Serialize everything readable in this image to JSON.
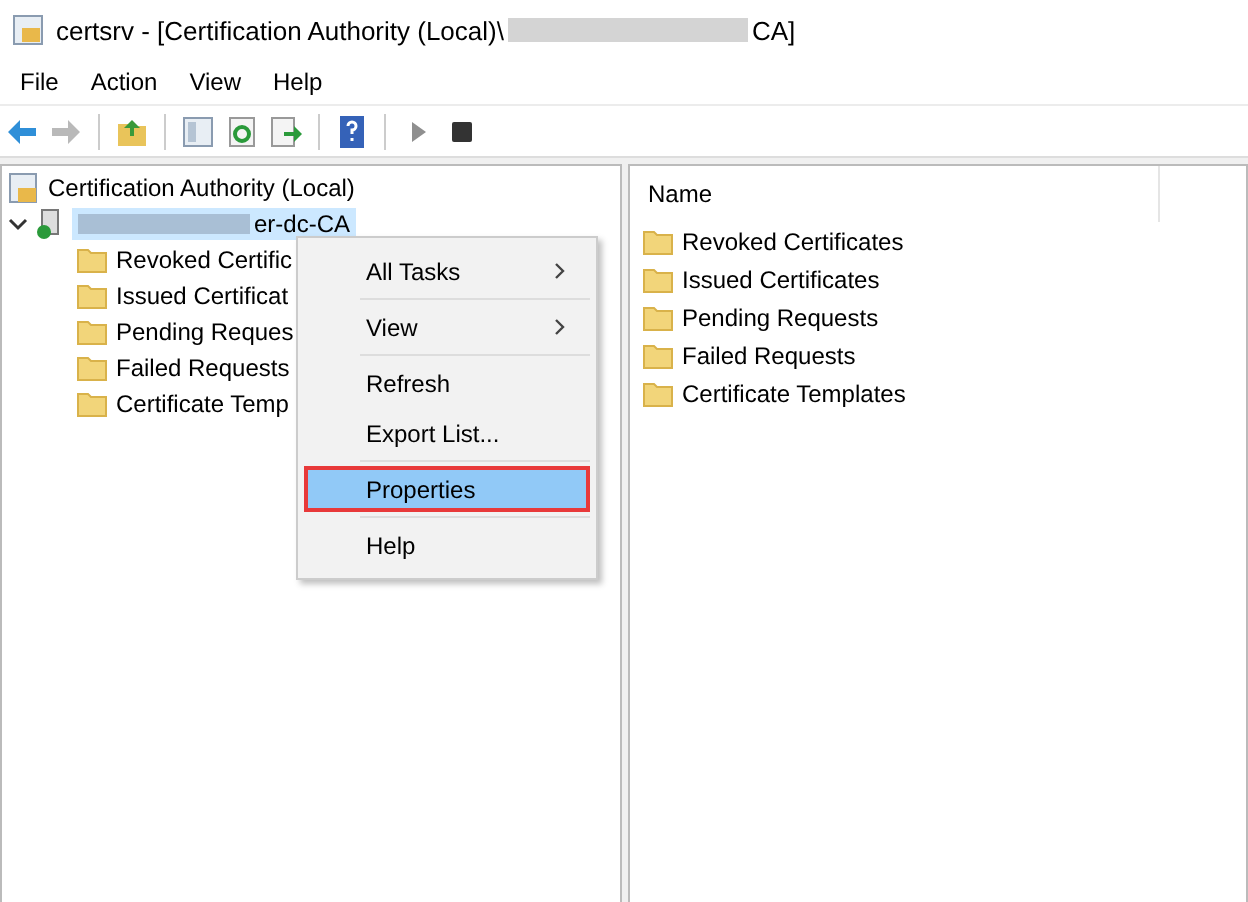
{
  "window": {
    "title": "certsrv - [Certification Authority (Local)\\",
    "title_end": "CA]"
  },
  "menu_bar": [
    "File",
    "Action",
    "View",
    "Help"
  ],
  "toolbar": [
    {
      "kind": "back",
      "disabled": false
    },
    {
      "kind": "forward",
      "disabled": true
    },
    {
      "kind": "separator"
    },
    {
      "kind": "up",
      "disabled": false
    },
    {
      "kind": "separator"
    },
    {
      "kind": "console",
      "disabled": false
    },
    {
      "kind": "refresh",
      "disabled": false
    },
    {
      "kind": "export",
      "disabled": false
    },
    {
      "kind": "separator"
    },
    {
      "kind": "help",
      "disabled": false
    },
    {
      "kind": "separator"
    },
    {
      "kind": "play",
      "disabled": true
    },
    {
      "kind": "stop",
      "disabled": false
    }
  ],
  "tree": {
    "root": "Certification Authority (Local)",
    "node": {
      "label": "er-dc-CA",
      "expanded": true,
      "selected": true,
      "children": [
        {
          "label": "Revoked Certific"
        },
        {
          "label": "Issued Certificat"
        },
        {
          "label": "Pending Reques"
        },
        {
          "label": "Failed Requests"
        },
        {
          "label": "Certificate Temp"
        }
      ]
    }
  },
  "list": {
    "columns": [
      "Name"
    ],
    "rows": [
      "Revoked Certificates",
      "Issued Certificates",
      "Pending Requests",
      "Failed Requests",
      "Certificate Templates"
    ]
  },
  "context_menu": [
    {
      "kind": "submenu",
      "label": "All Tasks",
      "selected": false
    },
    {
      "kind": "separator"
    },
    {
      "kind": "submenu",
      "label": "View",
      "selected": false
    },
    {
      "kind": "separator"
    },
    {
      "kind": "item",
      "label": "Refresh",
      "selected": false
    },
    {
      "kind": "item",
      "label": "Export List...",
      "selected": false
    },
    {
      "kind": "separator"
    },
    {
      "kind": "item",
      "label": "Properties",
      "selected": true
    },
    {
      "kind": "separator"
    },
    {
      "kind": "item",
      "label": "Help",
      "selected": false
    }
  ]
}
